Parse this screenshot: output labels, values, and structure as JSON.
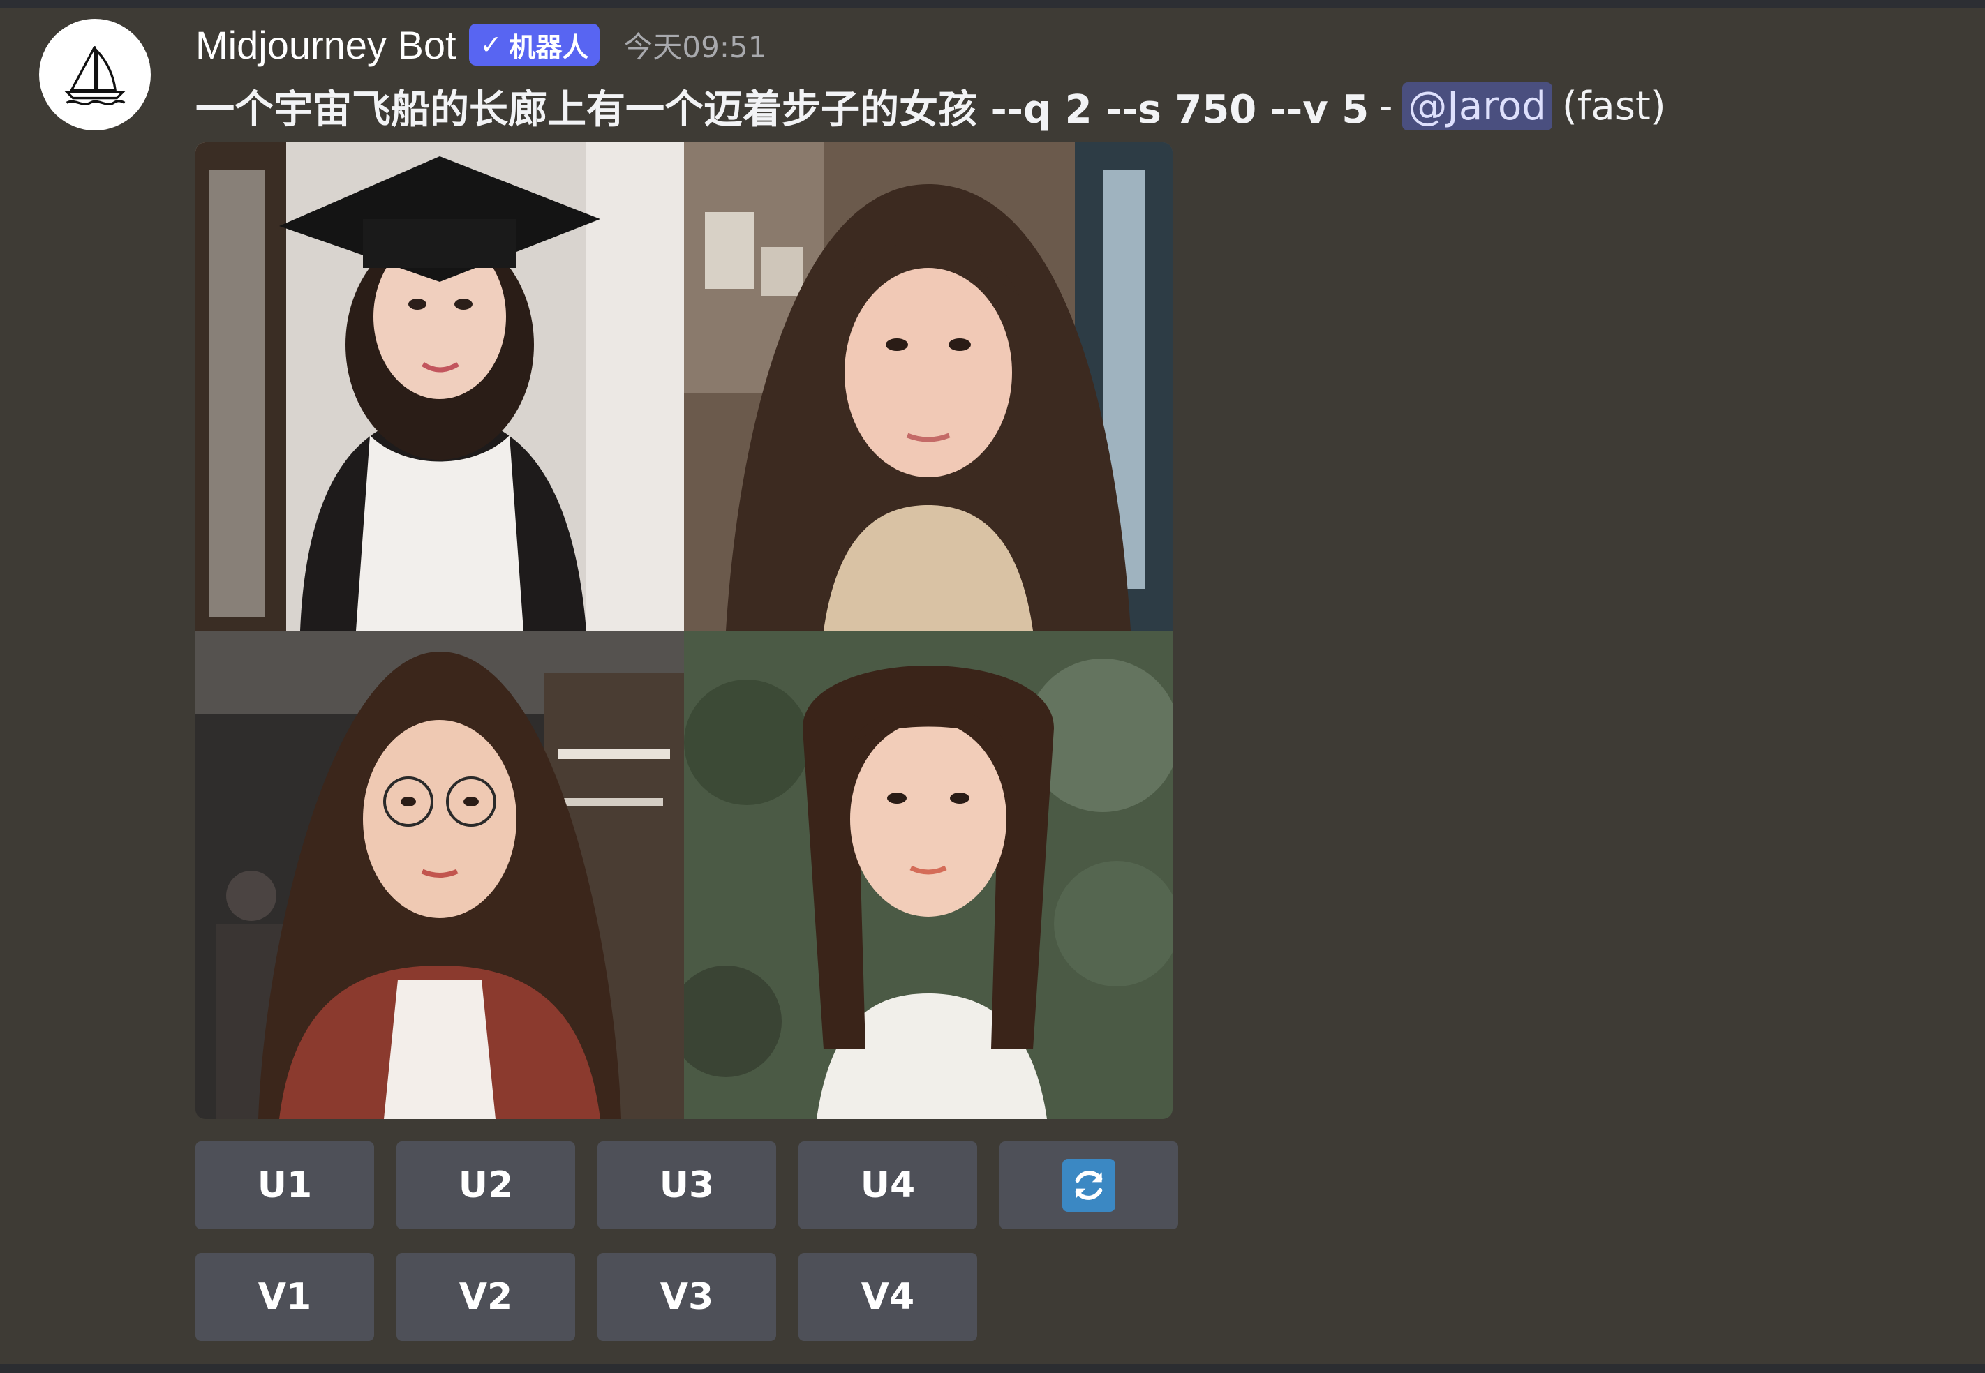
{
  "message": {
    "username": "Midjourney Bot",
    "badge": "机器人",
    "timestamp": "今天09:51",
    "prompt": "一个宇宙飞船的长廊上有一个迈着步子的女孩 --q 2 --s 750 --v 5",
    "separator": "-",
    "mention": "@Jarod",
    "mode": "(fast)"
  },
  "buttons": {
    "upscale": [
      "U1",
      "U2",
      "U3",
      "U4"
    ],
    "variation": [
      "V1",
      "V2",
      "V3",
      "V4"
    ],
    "reroll_icon": "refresh-icon"
  },
  "colors": {
    "background": "#3e3b35",
    "badge": "#5865f2",
    "button": "#4e5058",
    "mention_bg": "#4a4f7f",
    "reroll_icon_bg": "#3b88c3"
  }
}
